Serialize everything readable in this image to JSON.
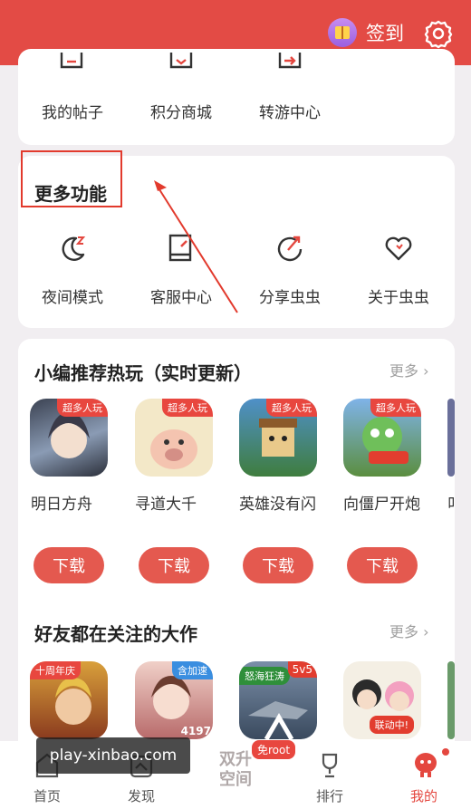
{
  "header": {
    "signin_label": "签到",
    "gift_icon": "gift-icon",
    "settings_icon": "gear-icon",
    "bg_color": "#e34b45"
  },
  "quick_links": [
    {
      "label": "我的帖子"
    },
    {
      "label": "积分商城"
    },
    {
      "label": "转游中心"
    }
  ],
  "more_features": {
    "title": "更多功能",
    "items": [
      {
        "label": "夜间模式",
        "icon": "moon-icon"
      },
      {
        "label": "客服中心",
        "icon": "notebook-icon"
      },
      {
        "label": "分享虫虫",
        "icon": "share-icon"
      },
      {
        "label": "关于虫虫",
        "icon": "heart-icon"
      }
    ]
  },
  "recommended": {
    "title": "小编推荐热玩（实时更新）",
    "more_label": "更多",
    "games": [
      {
        "name": "明日方舟",
        "badge": "超多人玩",
        "download": "下载"
      },
      {
        "name": "寻道大千",
        "badge": "超多人玩",
        "download": "下载"
      },
      {
        "name": "英雄没有闪",
        "badge": "超多人玩",
        "download": "下载"
      },
      {
        "name": "向僵尸开炮",
        "badge": "超多人玩",
        "download": "下载"
      },
      {
        "name": "叫"
      }
    ]
  },
  "friends": {
    "title": "好友都在关注的大作",
    "more_label": "更多",
    "games": [
      {
        "badge": "十周年庆"
      },
      {
        "badge": "含加速",
        "corner": "4197"
      },
      {
        "badge": "怒海狂涛",
        "corner": "5v5"
      },
      {
        "badge": "联动中!"
      }
    ]
  },
  "watermark": "play-xinbao.com",
  "bottom_nav": {
    "items": [
      {
        "label": "首页",
        "icon": "home-icon"
      },
      {
        "label": "发现",
        "icon": "discover-icon"
      },
      {
        "label": "双升空间",
        "icon": "dual-space-icon"
      },
      {
        "label": "排行",
        "icon": "trophy-icon"
      },
      {
        "label": "我的",
        "icon": "profile-icon"
      }
    ],
    "free_root_badge": "免root"
  }
}
